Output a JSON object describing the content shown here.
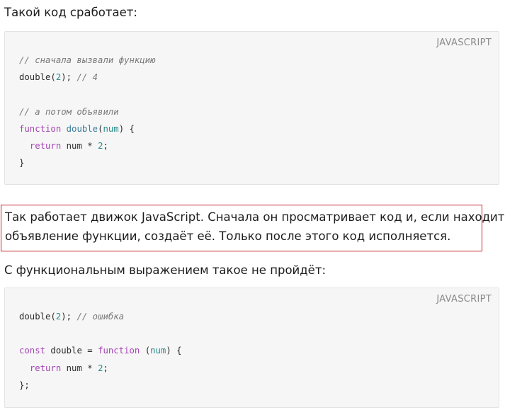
{
  "paragraphs": {
    "intro": "Такой код сработает:",
    "highlight_line1": "Так работает движок JavaScript. Сначала он просматривает код и, если находит",
    "highlight_line2": "объявление функции, создаёт её. Только после этого код исполняется.",
    "second_intro": "С функциональным выражением такое не пройдёт:"
  },
  "code_blocks": [
    {
      "language": "JAVASCRIPT",
      "lines": [
        [
          {
            "t": "cm",
            "v": "// сначала вызвали функцию"
          }
        ],
        [
          {
            "t": "pl",
            "v": "double("
          },
          {
            "t": "nm",
            "v": "2"
          },
          {
            "t": "pl",
            "v": "); "
          },
          {
            "t": "cm",
            "v": "// 4"
          }
        ],
        [],
        [
          {
            "t": "cm",
            "v": "// а потом объявили"
          }
        ],
        [
          {
            "t": "kw",
            "v": "function"
          },
          {
            "t": "pl",
            "v": " "
          },
          {
            "t": "fn",
            "v": "double"
          },
          {
            "t": "pl",
            "v": "("
          },
          {
            "t": "nm",
            "v": "num"
          },
          {
            "t": "pl",
            "v": ") {"
          }
        ],
        [
          {
            "t": "pl",
            "v": "  "
          },
          {
            "t": "kw",
            "v": "return"
          },
          {
            "t": "pl",
            "v": " num * "
          },
          {
            "t": "nm",
            "v": "2"
          },
          {
            "t": "pl",
            "v": ";"
          }
        ],
        [
          {
            "t": "pl",
            "v": "}"
          }
        ]
      ]
    },
    {
      "language": "JAVASCRIPT",
      "lines": [
        [
          {
            "t": "pl",
            "v": "double("
          },
          {
            "t": "nm",
            "v": "2"
          },
          {
            "t": "pl",
            "v": "); "
          },
          {
            "t": "cm",
            "v": "// ошибка"
          }
        ],
        [],
        [
          {
            "t": "kw",
            "v": "const"
          },
          {
            "t": "pl",
            "v": " double = "
          },
          {
            "t": "kw",
            "v": "function"
          },
          {
            "t": "pl",
            "v": " ("
          },
          {
            "t": "nm",
            "v": "num"
          },
          {
            "t": "pl",
            "v": ") {"
          }
        ],
        [
          {
            "t": "pl",
            "v": "  "
          },
          {
            "t": "kw",
            "v": "return"
          },
          {
            "t": "pl",
            "v": " num * "
          },
          {
            "t": "nm",
            "v": "2"
          },
          {
            "t": "pl",
            "v": ";"
          }
        ],
        [
          {
            "t": "pl",
            "v": "};"
          }
        ]
      ]
    }
  ],
  "colors": {
    "highlight_border": "#c8232c",
    "keyword": "#a444b5",
    "comment": "#7a7a7a",
    "number": "#2a8a8a",
    "code_background": "#f6f6f6"
  }
}
